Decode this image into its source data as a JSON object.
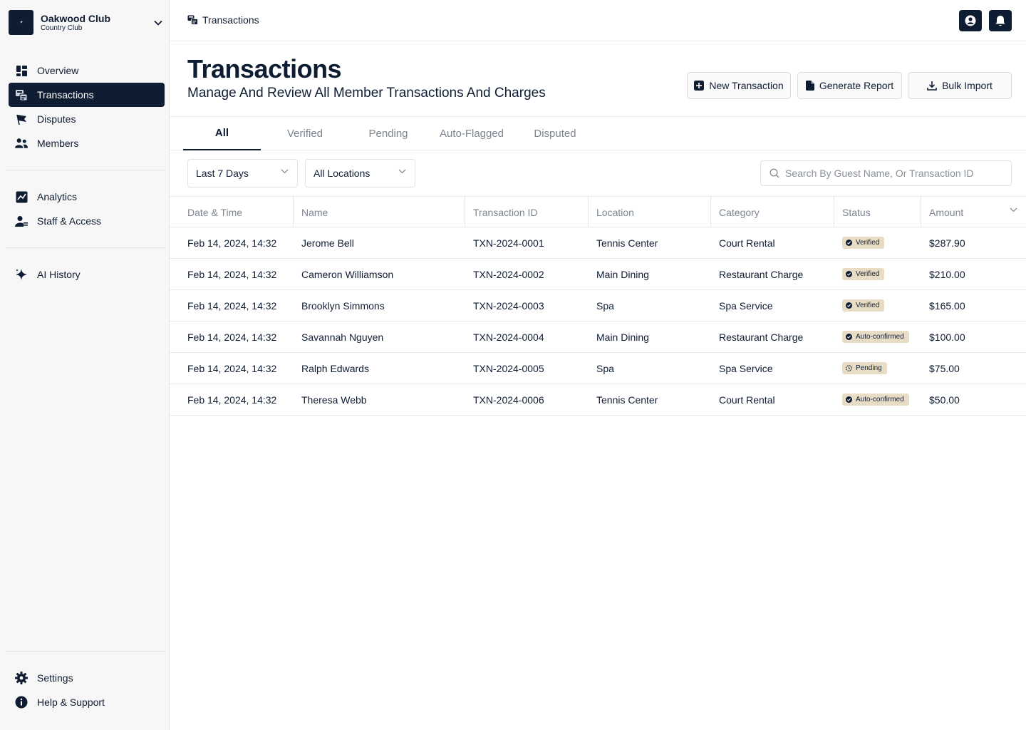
{
  "org": {
    "name": "Oakwood Club",
    "subtitle": "Country Club"
  },
  "nav_primary": [
    {
      "label": "Overview",
      "icon": "overview-icon",
      "active": false
    },
    {
      "label": "Transactions",
      "icon": "transactions-icon",
      "active": true
    },
    {
      "label": "Disputes",
      "icon": "flag-icon",
      "active": false
    },
    {
      "label": "Members",
      "icon": "members-icon",
      "active": false
    }
  ],
  "nav_secondary": [
    {
      "label": "Analytics",
      "icon": "analytics-icon"
    },
    {
      "label": "Staff & Access",
      "icon": "staff-icon"
    }
  ],
  "nav_tertiary": [
    {
      "label": "AI History",
      "icon": "sparkle-icon"
    }
  ],
  "nav_bottom": [
    {
      "label": "Settings",
      "icon": "gear-icon"
    },
    {
      "label": "Help & Support",
      "icon": "info-icon"
    }
  ],
  "breadcrumb": {
    "label": "Transactions"
  },
  "header": {
    "title": "Transactions",
    "subtitle": "Manage And Review All Member Transactions And Charges"
  },
  "actions": {
    "new_transaction": "New Transaction",
    "generate_report": "Generate Report",
    "bulk_import": "Bulk Import"
  },
  "tabs": [
    "All",
    "Verified",
    "Pending",
    "Auto-Flagged",
    "Disputed"
  ],
  "filters": {
    "date_range": "Last 7 Days",
    "location": "All Locations",
    "search_placeholder": "Search By Guest Name, Or Transaction ID"
  },
  "table": {
    "columns": [
      "Date & Time",
      "Name",
      "Transaction ID",
      "Location",
      "Category",
      "Status",
      "Amount"
    ],
    "rows": [
      {
        "datetime": "Feb 14, 2024, 14:32",
        "name": "Jerome Bell",
        "txn_id": "TXN-2024-0001",
        "location": "Tennis Center",
        "category": "Court Rental",
        "status": "Verified",
        "status_icon": "check-circle-icon",
        "amount": "$287.90"
      },
      {
        "datetime": "Feb 14, 2024, 14:32",
        "name": "Cameron Williamson",
        "txn_id": "TXN-2024-0002",
        "location": "Main Dining",
        "category": "Restaurant Charge",
        "status": "Verified",
        "status_icon": "check-circle-icon",
        "amount": "$210.00"
      },
      {
        "datetime": "Feb 14, 2024, 14:32",
        "name": "Brooklyn Simmons",
        "txn_id": "TXN-2024-0003",
        "location": "Spa",
        "category": "Spa Service",
        "status": "Verified",
        "status_icon": "check-circle-icon",
        "amount": "$165.00"
      },
      {
        "datetime": "Feb 14, 2024, 14:32",
        "name": "Savannah Nguyen",
        "txn_id": "TXN-2024-0004",
        "location": "Main Dining",
        "category": "Restaurant Charge",
        "status": "Auto-confirmed",
        "status_icon": "check-circle-icon",
        "amount": "$100.00"
      },
      {
        "datetime": "Feb 14, 2024, 14:32",
        "name": "Ralph Edwards",
        "txn_id": "TXN-2024-0005",
        "location": "Spa",
        "category": "Spa Service",
        "status": "Pending",
        "status_icon": "clock-icon",
        "amount": "$75.00"
      },
      {
        "datetime": "Feb 14, 2024, 14:32",
        "name": "Theresa Webb",
        "txn_id": "TXN-2024-0006",
        "location": "Tennis Center",
        "category": "Court Rental",
        "status": "Auto-confirmed",
        "status_icon": "check-circle-icon",
        "amount": "$50.00"
      }
    ]
  },
  "colors": {
    "primary": "#0f1d33",
    "badge_bg": "#e8dcc4",
    "muted_text": "#7d8592",
    "sidebar_bg": "#f7f7f7"
  }
}
